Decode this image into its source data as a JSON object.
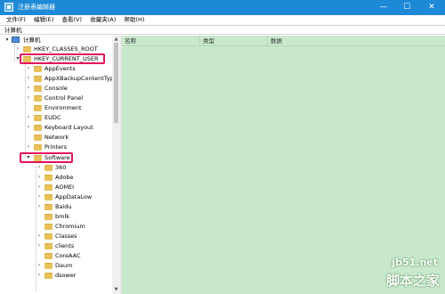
{
  "window": {
    "title": "注册表编辑器",
    "controls": {
      "minimize": "—",
      "maximize": "☐",
      "close": "✕"
    }
  },
  "menu": {
    "items": [
      {
        "label": "文件(F)"
      },
      {
        "label": "编辑(E)"
      },
      {
        "label": "查看(V)"
      },
      {
        "label": "收藏夹(A)"
      },
      {
        "label": "帮助(H)"
      }
    ]
  },
  "address": {
    "path": "计算机"
  },
  "tree": {
    "root": {
      "label": "计算机",
      "toggle": "▾",
      "icon": "computer-icon"
    },
    "hives": [
      {
        "label": "HKEY_CLASSES_ROOT",
        "toggle": "›",
        "highlighted": false
      },
      {
        "label": "HKEY_CURRENT_USER",
        "toggle": "▾",
        "highlighted": true
      }
    ],
    "current_user_children": [
      {
        "label": "AppEvents",
        "toggle": "›"
      },
      {
        "label": "AppXBackupContentType",
        "toggle": "›"
      },
      {
        "label": "Console",
        "toggle": "›"
      },
      {
        "label": "Control Panel",
        "toggle": "›"
      },
      {
        "label": "Environment",
        "toggle": ""
      },
      {
        "label": "EUDC",
        "toggle": "›"
      },
      {
        "label": "Keyboard Layout",
        "toggle": "›"
      },
      {
        "label": "Network",
        "toggle": ""
      },
      {
        "label": "Printers",
        "toggle": "›"
      },
      {
        "label": "Software",
        "toggle": "▾",
        "highlighted": true
      }
    ],
    "software_children": [
      {
        "label": "360",
        "toggle": "›"
      },
      {
        "label": "Adobe",
        "toggle": "›"
      },
      {
        "label": "AOMEI",
        "toggle": "›"
      },
      {
        "label": "AppDataLow",
        "toggle": "›"
      },
      {
        "label": "Baidu",
        "toggle": "›"
      },
      {
        "label": "bmlk",
        "toggle": ""
      },
      {
        "label": "Chromium",
        "toggle": ""
      },
      {
        "label": "Classes",
        "toggle": "›"
      },
      {
        "label": "clients",
        "toggle": "›"
      },
      {
        "label": "CoreAAC",
        "toggle": ""
      },
      {
        "label": "Daum",
        "toggle": "›"
      },
      {
        "label": "dsower",
        "toggle": "›"
      }
    ]
  },
  "list": {
    "columns": {
      "name": "名称",
      "type": "类型",
      "data": "数据"
    }
  },
  "watermark": {
    "site": "jb51.net",
    "name": "脚本之家"
  },
  "colors": {
    "titlebar": "#1e89d6",
    "list_background": "#c8e9cc",
    "highlight": "#e2145f",
    "folder": "#e8c15a"
  }
}
